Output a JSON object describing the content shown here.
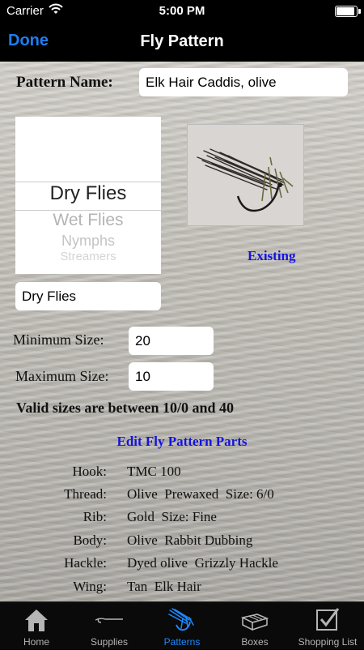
{
  "status": {
    "carrier": "Carrier",
    "time": "5:00 PM"
  },
  "nav": {
    "done": "Done",
    "title": "Fly Pattern"
  },
  "form": {
    "pattern_name_label": "Pattern Name:",
    "pattern_name_value": "Elk Hair Caddis, olive",
    "picker_options": [
      "Dry Flies",
      "Wet Flies",
      "Nymphs",
      "Streamers"
    ],
    "category_value": "Dry Flies",
    "existing_link": "Existing",
    "min_size_label": "Minimum Size:",
    "min_size_value": "20",
    "max_size_label": "Maximum Size:",
    "max_size_value": "10",
    "valid_sizes_text": "Valid sizes are between 10/0 and 40",
    "edit_parts_link": "Edit Fly Pattern Parts"
  },
  "parts": [
    {
      "label": "Hook:",
      "value": "TMC 100"
    },
    {
      "label": "Thread:",
      "value": "Olive  Prewaxed  Size: 6/0"
    },
    {
      "label": "Rib:",
      "value": "Gold  Size: Fine"
    },
    {
      "label": "Body:",
      "value": "Olive  Rabbit Dubbing"
    },
    {
      "label": "Hackle:",
      "value": "Dyed olive  Grizzly Hackle"
    },
    {
      "label": "Wing:",
      "value": "Tan  Elk Hair"
    }
  ],
  "tabs": [
    {
      "label": "Home",
      "icon": "home-icon"
    },
    {
      "label": "Supplies",
      "icon": "hook-icon"
    },
    {
      "label": "Patterns",
      "icon": "fly-icon"
    },
    {
      "label": "Boxes",
      "icon": "box-icon"
    },
    {
      "label": "Shopping List",
      "icon": "checkbox-icon"
    }
  ],
  "active_tab": "Patterns",
  "colors": {
    "accent": "#1c7ef5",
    "link": "#1313e0",
    "tab_inactive": "#b5b5b5"
  }
}
